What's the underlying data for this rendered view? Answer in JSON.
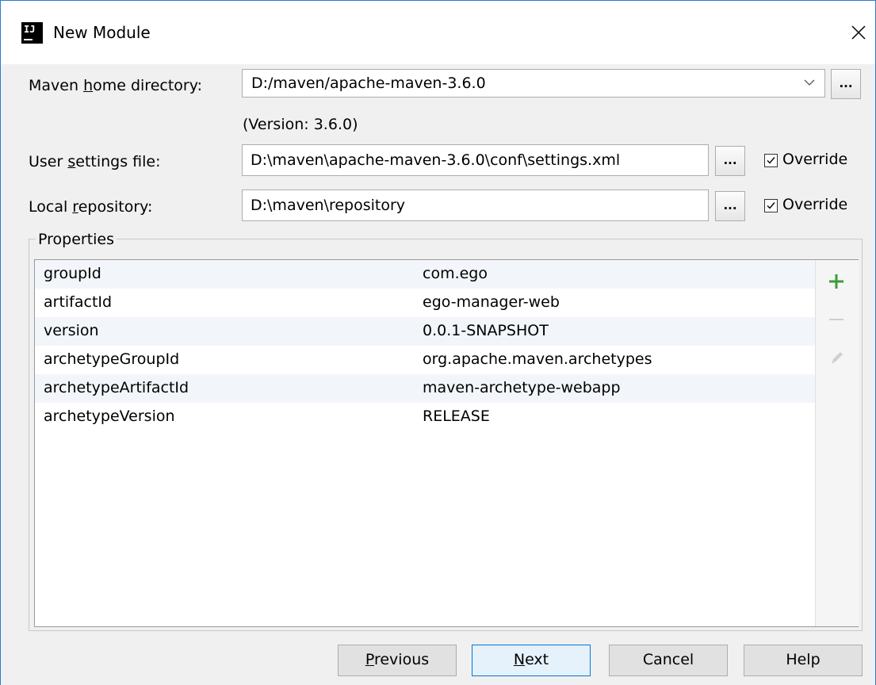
{
  "window": {
    "title": "New Module",
    "app_icon_text": "IJ"
  },
  "maven_home": {
    "label_prefix": "Maven ",
    "label_mnemonic": "h",
    "label_suffix": "ome directory:",
    "value": "D:/maven/apache-maven-3.6.0",
    "version": "(Version: 3.6.0)",
    "browse_label": "..."
  },
  "user_settings": {
    "label_prefix": "User ",
    "label_mnemonic": "s",
    "label_suffix": "ettings file:",
    "value": "D:\\maven\\apache-maven-3.6.0\\conf\\settings.xml",
    "browse_label": "...",
    "override_label": "Override",
    "override_checked": true
  },
  "local_repo": {
    "label_prefix": "Local ",
    "label_mnemonic": "r",
    "label_suffix": "epository:",
    "value": "D:\\maven\\repository",
    "browse_label": "...",
    "override_label": "Override",
    "override_checked": true
  },
  "properties": {
    "title": "Properties",
    "rows": [
      {
        "key": "groupId",
        "value": "com.ego"
      },
      {
        "key": "artifactId",
        "value": "ego-manager-web"
      },
      {
        "key": "version",
        "value": "0.0.1-SNAPSHOT"
      },
      {
        "key": "archetypeGroupId",
        "value": "org.apache.maven.archetypes"
      },
      {
        "key": "archetypeArtifactId",
        "value": "maven-archetype-webapp"
      },
      {
        "key": "archetypeVersion",
        "value": "RELEASE"
      }
    ],
    "tools": [
      "add-icon",
      "remove-icon",
      "edit-icon"
    ]
  },
  "buttons": {
    "previous": {
      "mnemonic": "P",
      "rest": "revious"
    },
    "next": {
      "mnemonic": "N",
      "rest": "ext"
    },
    "cancel": "Cancel",
    "help": "Help"
  },
  "colors": {
    "accent": "#0078d7",
    "add": "#3c9c3c",
    "title_border": "#2b7bd3"
  }
}
